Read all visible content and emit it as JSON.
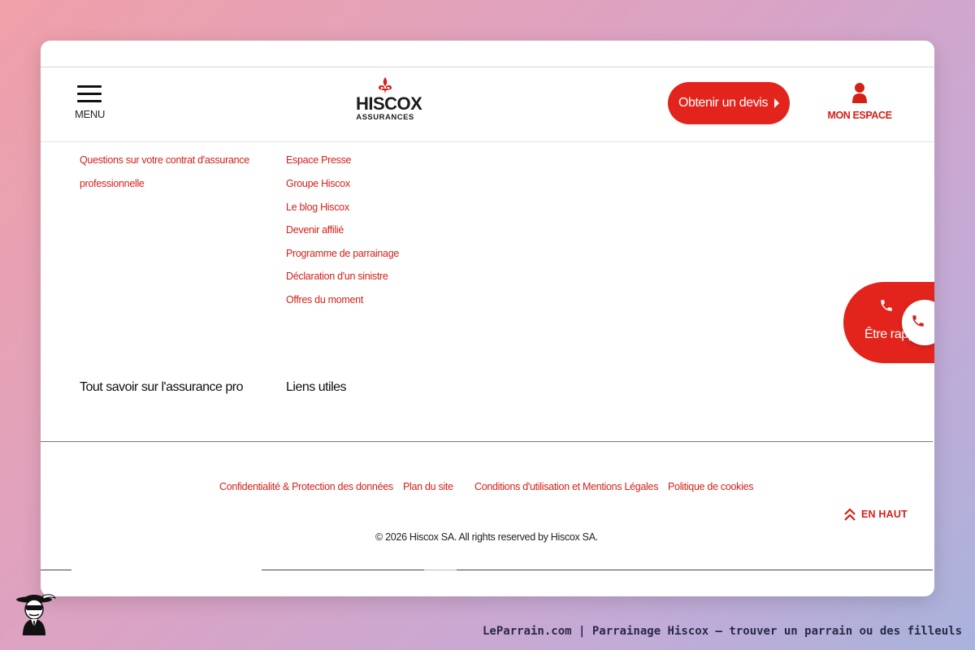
{
  "header": {
    "menu_label": "MENU",
    "logo_line1": "HISCOX",
    "logo_line2": "ASSURANCES",
    "quote_button": "Obtenir un devis",
    "account_label": "MON ESPACE"
  },
  "col1": {
    "links": [
      "Questions sur votre contrat d'assurance",
      "professionnelle"
    ],
    "heading": "Tout savoir sur l'assurance pro"
  },
  "col2": {
    "links": [
      "Espace Presse",
      "Groupe Hiscox",
      "Le blog Hiscox",
      "Devenir affilié",
      "Programme de parrainage",
      "Déclaration d'un sinistre",
      "Offres du moment"
    ],
    "heading": "Liens utiles"
  },
  "callback": {
    "label": "Être rappelé"
  },
  "footer": {
    "links": [
      "Confidentialité & Protection des données",
      "Plan du site",
      "Conditions d'utilisation et Mentions Légales",
      "Politique de cookies"
    ],
    "back_to_top": "EN HAUT",
    "copyright": "© 2026 Hiscox SA. All rights reserved by Hiscox SA."
  },
  "caption": "LeParrain.com | Parrainage Hiscox — trouver un parrain ou des filleuls",
  "colors": {
    "accent": "#e2241c",
    "link": "#d52018"
  },
  "icons": [
    "hamburger-icon",
    "fleur-de-lis-icon",
    "arrow-right-icon",
    "user-icon",
    "phone-icon",
    "double-chevron-up-icon",
    "mascot-icon"
  ]
}
